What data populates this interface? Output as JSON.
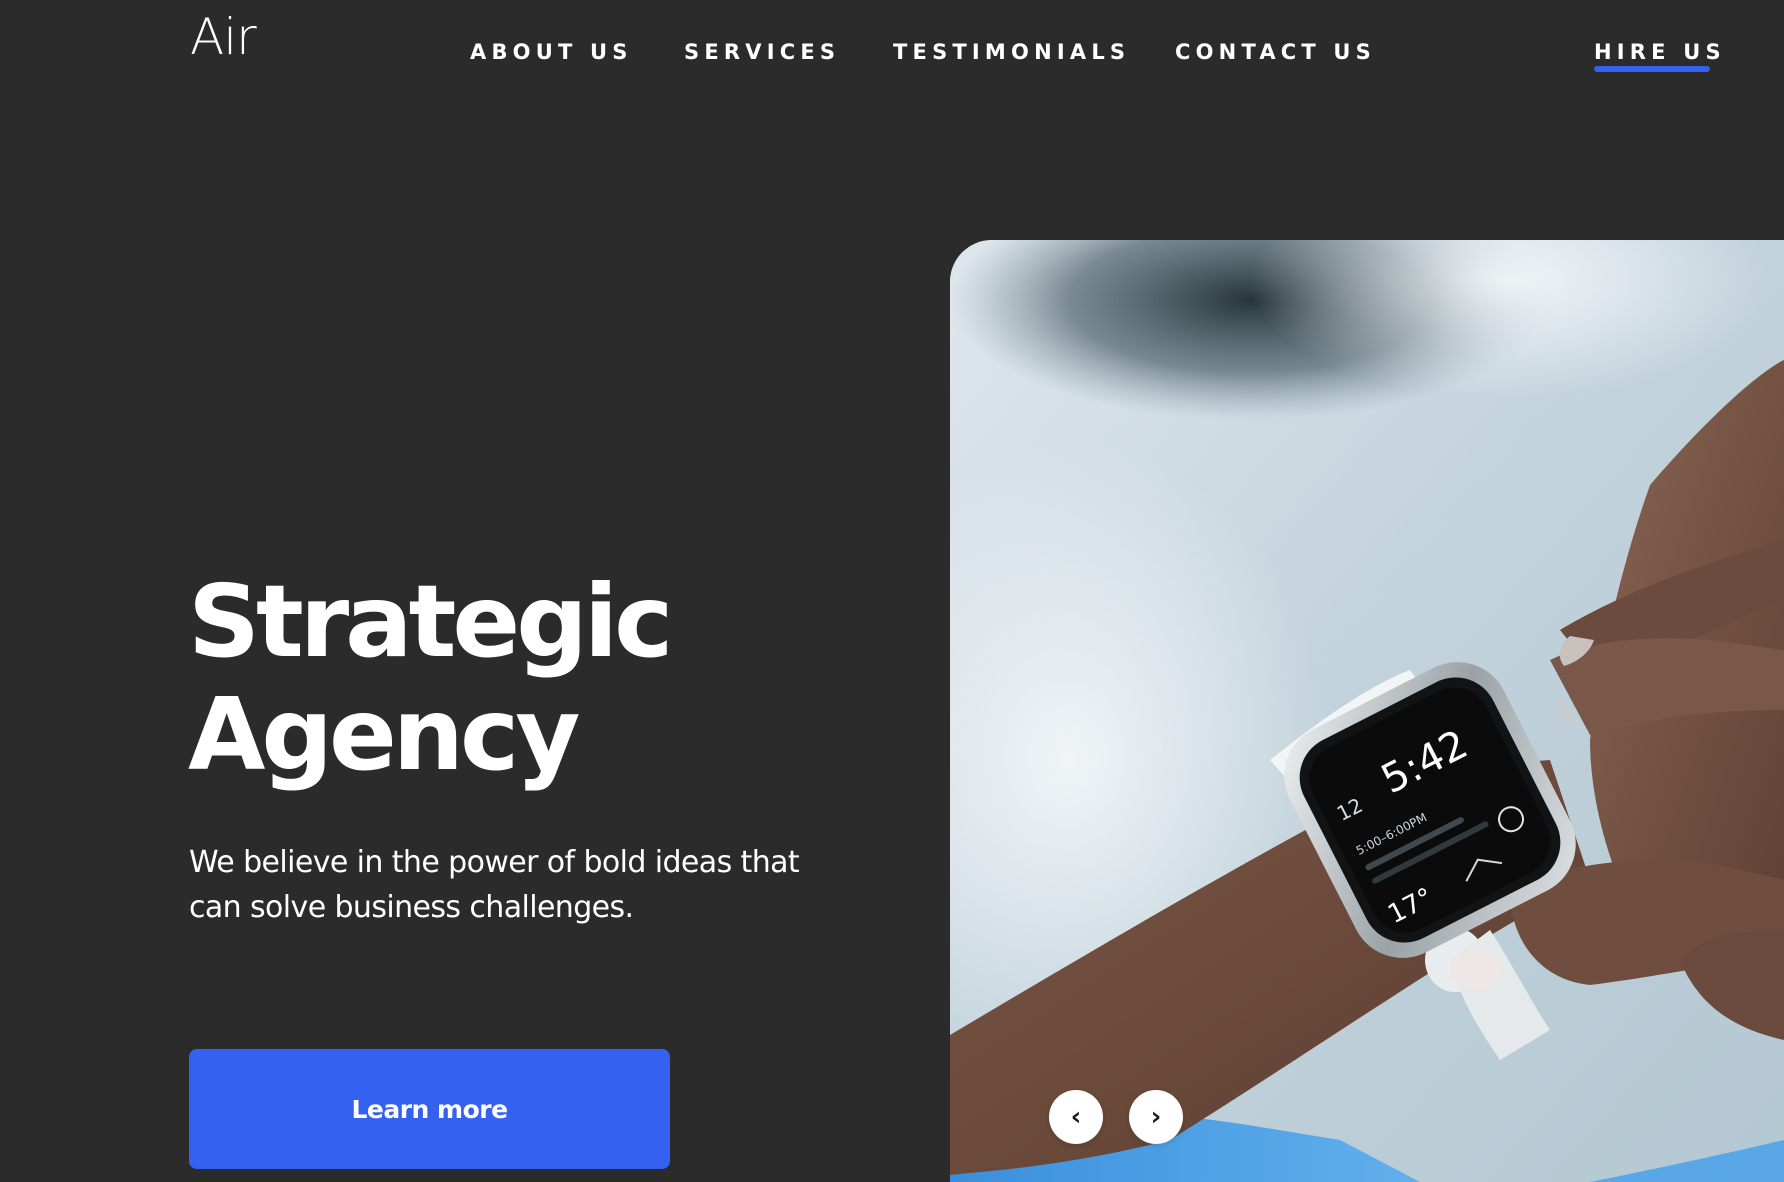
{
  "brand": {
    "logo_text": "Air"
  },
  "nav": {
    "items": [
      {
        "label": "ABOUT US"
      },
      {
        "label": "SERVICES"
      },
      {
        "label": "TESTIMONIALS"
      },
      {
        "label": "CONTACT US"
      }
    ],
    "hire_label": "HIRE US"
  },
  "hero": {
    "title_line1": "Strategic",
    "title_line2": "Agency",
    "subtitle": "We believe in the power of bold ideas that can solve business challenges.",
    "cta_label": "Learn more",
    "image": {
      "watch_time": "5:42",
      "watch_date": "12",
      "watch_event": "5:00–6:00PM",
      "watch_temp": "17°"
    }
  },
  "slider": {
    "prev_icon": "chevron-left-icon",
    "next_icon": "chevron-right-icon",
    "prev_glyph": "‹",
    "next_glyph": "›"
  },
  "colors": {
    "background": "#2b2b2c",
    "accent": "#3561f0",
    "text": "#ffffff"
  }
}
